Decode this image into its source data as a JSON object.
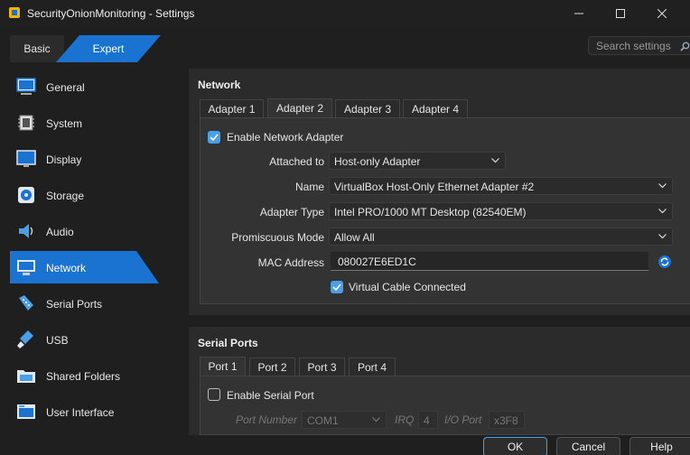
{
  "window": {
    "title": "SecurityOnionMonitoring - Settings"
  },
  "mode_tabs": {
    "basic": "Basic",
    "expert": "Expert"
  },
  "search": {
    "placeholder": "Search settings"
  },
  "sidebar": {
    "items": [
      {
        "label": "General",
        "icon": "general-icon"
      },
      {
        "label": "System",
        "icon": "system-icon"
      },
      {
        "label": "Display",
        "icon": "display-icon"
      },
      {
        "label": "Storage",
        "icon": "storage-icon"
      },
      {
        "label": "Audio",
        "icon": "audio-icon"
      },
      {
        "label": "Network",
        "icon": "network-icon",
        "active": true
      },
      {
        "label": "Serial Ports",
        "icon": "serial-ports-icon"
      },
      {
        "label": "USB",
        "icon": "usb-icon"
      },
      {
        "label": "Shared Folders",
        "icon": "shared-folders-icon"
      },
      {
        "label": "User Interface",
        "icon": "user-interface-icon"
      }
    ]
  },
  "network": {
    "title": "Network",
    "tabs": [
      "Adapter 1",
      "Adapter 2",
      "Adapter 3",
      "Adapter 4"
    ],
    "active_tab": "Adapter 2",
    "enable_label": "Enable Network Adapter",
    "enable_checked": true,
    "attached_to_label": "Attached to",
    "attached_to_value": "Host-only Adapter",
    "name_label": "Name",
    "name_value": "VirtualBox Host-Only Ethernet Adapter #2",
    "adapter_type_label": "Adapter Type",
    "adapter_type_value": "Intel PRO/1000 MT Desktop (82540EM)",
    "promiscuous_label": "Promiscuous Mode",
    "promiscuous_value": "Allow All",
    "mac_label": "MAC Address",
    "mac_value": "080027E6ED1C",
    "cable_label": "Virtual Cable Connected",
    "cable_checked": true
  },
  "serial": {
    "title": "Serial Ports",
    "tabs": [
      "Port 1",
      "Port 2",
      "Port 3",
      "Port 4"
    ],
    "active_tab": "Port 1",
    "enable_label": "Enable Serial Port",
    "enable_checked": false,
    "port_number_label": "Port Number",
    "port_number_value": "COM1",
    "irq_label": "IRQ",
    "irq_value": "4",
    "io_port_label": "I/O Port",
    "io_port_value": "x3F8"
  },
  "buttons": {
    "ok": "OK",
    "cancel": "Cancel",
    "help": "Help"
  },
  "colors": {
    "accent": "#1a73d1",
    "check": "#4a9fe8",
    "background": "#1f1f1f",
    "panel": "#2b2b2b"
  }
}
